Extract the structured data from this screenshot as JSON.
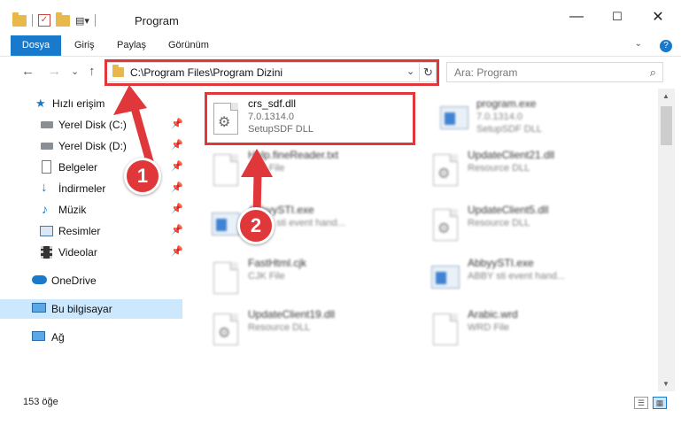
{
  "window": {
    "title": "Program",
    "controls": {
      "minimize": "—",
      "maximize": "☐",
      "close": "✕"
    }
  },
  "ribbon": {
    "tabs": [
      "Dosya",
      "Giriş",
      "Paylaş",
      "Görünüm"
    ],
    "help": "?"
  },
  "navigation": {
    "back": "←",
    "forward": "→",
    "recent": "⌄",
    "up": "↑",
    "address": "C:\\Program Files\\Program Dizini",
    "refresh": "↻",
    "search_placeholder": "Ara: Program"
  },
  "sidebar": {
    "items": [
      {
        "label": "Hızlı erişim",
        "icon": "star-icon",
        "pinned": false
      },
      {
        "label": "Yerel Disk (C:)",
        "icon": "drive-icon",
        "pinned": true
      },
      {
        "label": "Yerel Disk (D:)",
        "icon": "drive-icon",
        "pinned": true
      },
      {
        "label": "Belgeler",
        "icon": "documents-icon",
        "pinned": true
      },
      {
        "label": "İndirmeler",
        "icon": "download-icon",
        "pinned": true
      },
      {
        "label": "Müzik",
        "icon": "music-icon",
        "pinned": true
      },
      {
        "label": "Resimler",
        "icon": "pictures-icon",
        "pinned": true
      },
      {
        "label": "Videolar",
        "icon": "videos-icon",
        "pinned": true
      },
      {
        "label": "OneDrive",
        "icon": "onedrive-icon",
        "pinned": false
      },
      {
        "label": "Bu bilgisayar",
        "icon": "computer-icon",
        "pinned": false
      },
      {
        "label": "Ağ",
        "icon": "network-icon",
        "pinned": false
      }
    ]
  },
  "files": [
    {
      "name": "crs_sdf.dll",
      "line2": "7.0.1314.0",
      "line3": "SetupSDF DLL",
      "icon": "dll-file-icon"
    },
    {
      "name": "program.exe",
      "line2": "7.0.1314.0",
      "line3": "SetupSDF DLL",
      "icon": "exe-file-icon"
    },
    {
      "name": "Help.fineReader.txt",
      "line2": "TXT File",
      "line3": "",
      "icon": "txt-file-icon"
    },
    {
      "name": "UpdateClient21.dll",
      "line2": "Resource DLL",
      "line3": "",
      "icon": "dll-file-icon"
    },
    {
      "name": "AbbyySTI.exe",
      "line2": "ABBY sti event hand...",
      "line3": "",
      "icon": "exe-file-icon"
    },
    {
      "name": "UpdateClient5.dll",
      "line2": "Resource DLL",
      "line3": "",
      "icon": "dll-file-icon"
    },
    {
      "name": "FastHtml.cjk",
      "line2": "CJK File",
      "line3": "",
      "icon": "file-icon"
    },
    {
      "name": "AbbyySTI.exe",
      "line2": "ABBY sti event hand...",
      "line3": "",
      "icon": "exe-file-icon"
    },
    {
      "name": "UpdateClient19.dll",
      "line2": "Resource DLL",
      "line3": "",
      "icon": "dll-file-icon"
    },
    {
      "name": "Arabic.wrd",
      "line2": "WRD File",
      "line3": "",
      "icon": "file-icon"
    }
  ],
  "status": {
    "item_count": "153 öğe"
  },
  "annotations": {
    "badge1": "1",
    "badge2": "2",
    "color": "#e0383a"
  },
  "colors": {
    "accent": "#1979ca",
    "selection": "#cce8ff"
  }
}
